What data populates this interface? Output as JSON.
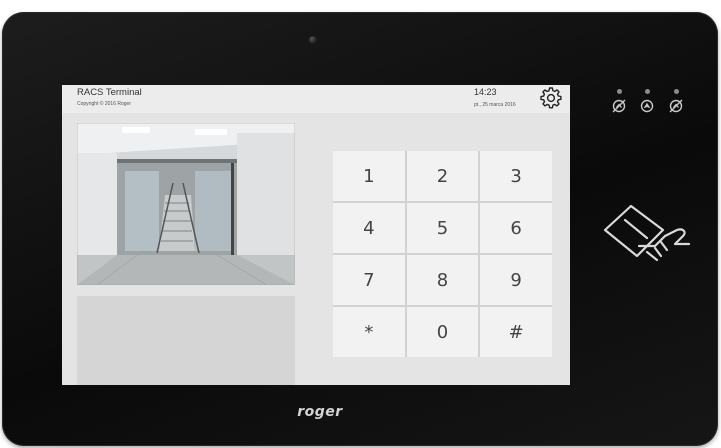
{
  "header": {
    "title": "RACS Terminal",
    "copyright": "Copyright © 2016 Roger",
    "time": "14:23",
    "date": "pt., 25 marca 2016"
  },
  "settings": {
    "icon": "gear-icon"
  },
  "keypad": {
    "keys": [
      "1",
      "2",
      "3",
      "4",
      "5",
      "6",
      "7",
      "8",
      "9",
      "*",
      "0",
      "#"
    ]
  },
  "status_indicators": {
    "icons": [
      "card-disabled-icon",
      "card-active-icon",
      "card-disabled-icon"
    ]
  },
  "reader": {
    "icon": "contactless-card-reader-icon"
  },
  "brand": {
    "logo": "roger"
  },
  "colors": {
    "bezel": "#111111",
    "screen_bg": "#e4e4e4",
    "key_bg": "#f2f2f2",
    "key_text": "#444444",
    "icon_gray": "#c8c8c8"
  }
}
